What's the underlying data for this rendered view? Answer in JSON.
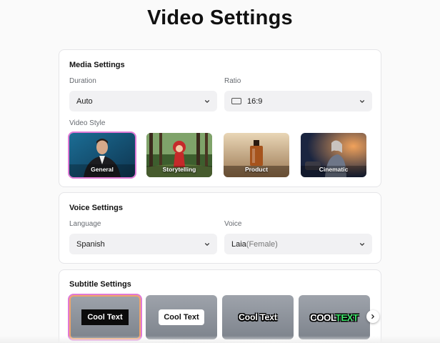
{
  "page": {
    "title": "Video Settings"
  },
  "media": {
    "title": "Media Settings",
    "duration_label": "Duration",
    "duration_value": "Auto",
    "ratio_label": "Ratio",
    "ratio_value": "16:9",
    "style_label": "Video Style",
    "styles": [
      {
        "label": "General",
        "selected": true
      },
      {
        "label": "Storytelling",
        "selected": false
      },
      {
        "label": "Product",
        "selected": false
      },
      {
        "label": "Cinematic",
        "selected": false
      }
    ]
  },
  "voice": {
    "title": "Voice Settings",
    "language_label": "Language",
    "language_value": "Spanish",
    "voice_label": "Voice",
    "voice_name": "Laia",
    "voice_gender": "(Female)"
  },
  "subtitle": {
    "title": "Subtitle Settings",
    "styles": [
      {
        "text": "Cool Text",
        "selected": true
      },
      {
        "text": "Cool Text",
        "selected": false
      },
      {
        "text": "Cool Text",
        "selected": false
      },
      {
        "word1": "COOL",
        "word2": "TEXT",
        "selected": false
      }
    ]
  },
  "colors": {
    "selection_outline": "#e07ad6",
    "accent_green": "#3fe36a"
  },
  "icons": {
    "dropdown": "chevron-down-icon",
    "ratio": "aspect-ratio-icon",
    "next": "chevron-right-icon"
  }
}
